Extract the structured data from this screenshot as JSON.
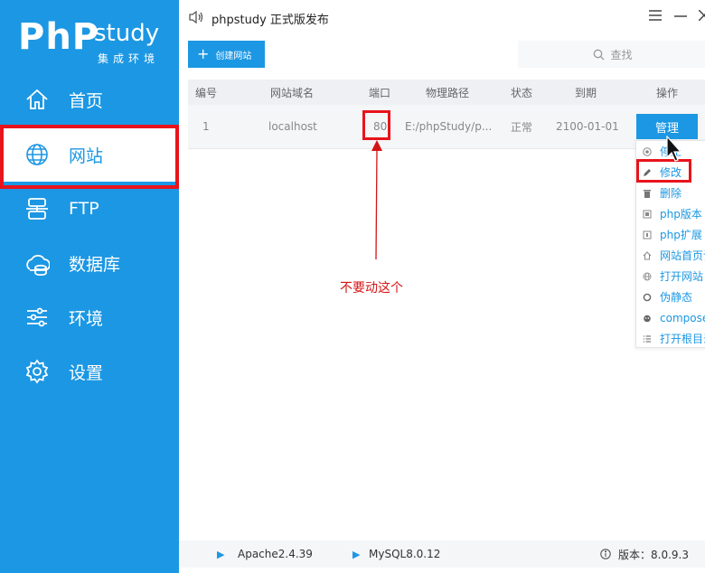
{
  "app": {
    "title": "phpstudy 正式版发布",
    "logo_main": "PhP",
    "logo_study": "study",
    "logo_sub": "集成环境"
  },
  "sidebar": {
    "items": [
      {
        "label": "首页",
        "icon": "home-icon"
      },
      {
        "label": "网站",
        "icon": "globe-icon",
        "active": true
      },
      {
        "label": "FTP",
        "icon": "ftp-icon"
      },
      {
        "label": "数据库",
        "icon": "database-icon"
      },
      {
        "label": "环境",
        "icon": "sliders-icon"
      },
      {
        "label": "设置",
        "icon": "gear-icon"
      }
    ]
  },
  "toolbar": {
    "create_label": "创建网站",
    "search_placeholder": "查找"
  },
  "table": {
    "headers": [
      "编号",
      "网站域名",
      "端口",
      "物理路径",
      "状态",
      "到期",
      "操作"
    ],
    "rows": [
      {
        "id": "1",
        "domain": "localhost",
        "port": "80",
        "path": "E:/phpStudy/p...",
        "status": "正常",
        "expire": "2100-01-01",
        "action": "管理"
      }
    ]
  },
  "dropdown": {
    "items": [
      {
        "label": "停止",
        "icon": "stop-icon"
      },
      {
        "label": "修改",
        "icon": "pencil-icon"
      },
      {
        "label": "删除",
        "icon": "trash-icon"
      },
      {
        "label": "php版本",
        "icon": "php-icon"
      },
      {
        "label": "php扩展",
        "icon": "puzzle-icon"
      },
      {
        "label": "网站首页设置",
        "icon": "home-small-icon"
      },
      {
        "label": "打开网站",
        "icon": "globe-small-icon"
      },
      {
        "label": "伪静态",
        "icon": "cycle-icon"
      },
      {
        "label": "composer",
        "icon": "composer-icon"
      },
      {
        "label": "打开根目录",
        "icon": "list-icon"
      }
    ]
  },
  "annotation": {
    "note": "不要动这个"
  },
  "footer": {
    "apache": "Apache2.4.39",
    "mysql": "MySQL8.0.12",
    "version_label": "版本：8.0.9.3"
  },
  "colors": {
    "accent": "#1c97e3",
    "highlight": "#e8141b"
  }
}
